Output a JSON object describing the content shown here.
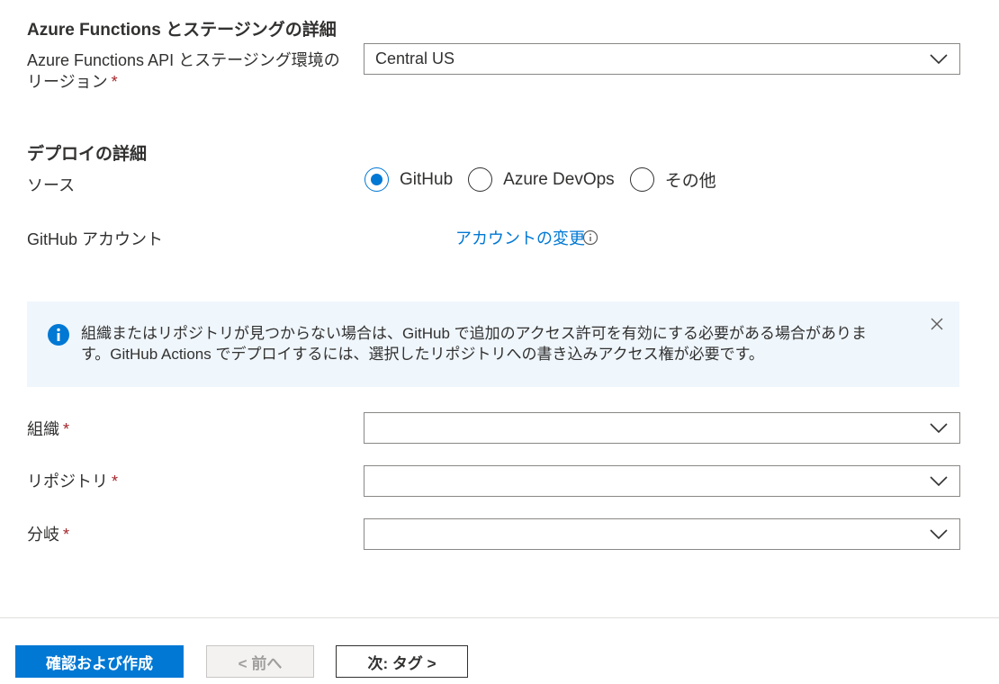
{
  "functions": {
    "title": "Azure Functions とステージングの詳細",
    "region_label_line1": "Azure Functions API とステージング環境の",
    "region_label_line2": "リージョン",
    "region_value": "Central US"
  },
  "deploy": {
    "title": "デプロイの詳細",
    "source_label": "ソース",
    "source_options": [
      "GitHub",
      "Azure DevOps",
      "その他"
    ],
    "source_selected": "GitHub",
    "account_label": "GitHub アカウント",
    "change_account_link": "アカウントの変更"
  },
  "banner": {
    "text": "組織またはリポジトリが見つからない場合は、GitHub で追加のアクセス許可を有効にする必要がある場合があります。GitHub Actions でデプロイするには、選択したリポジトリへの書き込みアクセス権が必要です。"
  },
  "fields": {
    "org_label": "組織",
    "repo_label": "リポジトリ",
    "branch_label": "分岐",
    "org_value": "",
    "repo_value": "",
    "branch_value": ""
  },
  "required_marker": "*",
  "footer": {
    "review_create": "確認および作成",
    "previous": "< 前へ",
    "next": "次: タグ >"
  },
  "colors": {
    "accent": "#0078d4",
    "required": "#a4262c",
    "banner_bg": "#eff6fc"
  }
}
